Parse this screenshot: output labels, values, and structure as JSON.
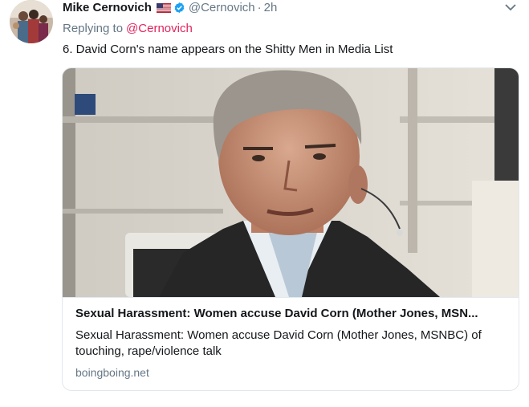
{
  "tweet": {
    "display_name": "Mike Cernovich",
    "flag_icon": "us-flag-icon",
    "verified_icon": "verified-badge-icon",
    "handle": "@Cernovich",
    "separator": "·",
    "time": "2h",
    "menu_icon": "chevron-down-icon",
    "reply": {
      "prefix": "Replying to",
      "handle": "@Cernovich"
    },
    "text": "6. David Corn's name appears on the Shitty Men in Media List"
  },
  "card": {
    "title": "Sexual Harassment: Women accuse David Corn (Mother Jones, MSN...",
    "description": "Sexual Harassment: Women accuse David Corn (Mother Jones, MSNBC) of touching, rape/violence talk",
    "domain": "boingboing.net"
  },
  "colors": {
    "link": "#e0245e",
    "secondary_text": "#657786",
    "verified": "#1da1f2",
    "border": "#e1e8ed"
  }
}
